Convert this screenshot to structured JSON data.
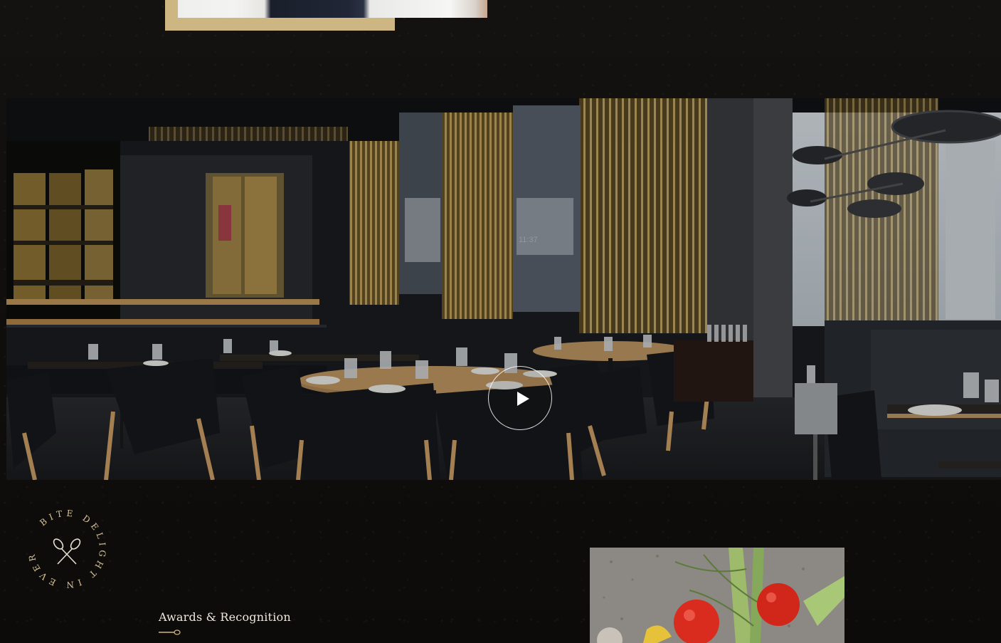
{
  "badge": {
    "text": "BITE DELIGHT IN EVERY"
  },
  "awards": {
    "heading": "Awards & Recognition"
  },
  "video": {
    "play_label": "Play video",
    "overlay_text": "11:37"
  },
  "colors": {
    "accent": "#cdb681",
    "background": "#0f0d0b",
    "heading_text": "#efe9dc"
  }
}
